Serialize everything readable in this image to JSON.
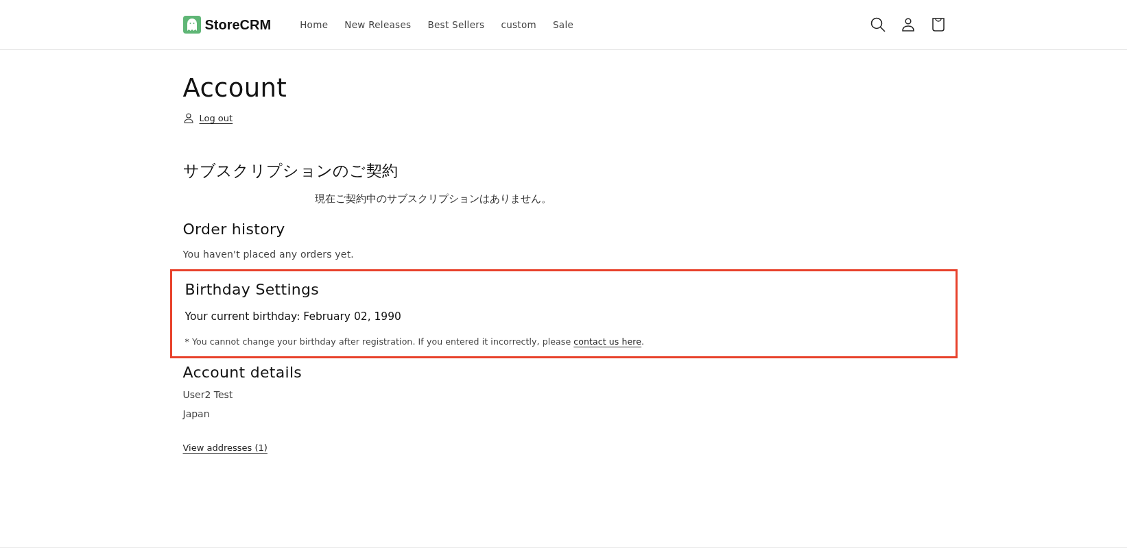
{
  "header": {
    "logo_text": "StoreCRM",
    "nav": [
      {
        "label": "Home"
      },
      {
        "label": "New Releases"
      },
      {
        "label": "Best Sellers"
      },
      {
        "label": "custom"
      },
      {
        "label": "Sale"
      }
    ]
  },
  "account": {
    "title": "Account",
    "logout": "Log out"
  },
  "subscriptions": {
    "heading": "サブスクリプションのご契約",
    "message": "現在ご契約中のサブスクリプションはありません。"
  },
  "order_history": {
    "heading": "Order history",
    "message": "You haven't placed any orders yet."
  },
  "birthday": {
    "highlighted": true,
    "heading": "Birthday Settings",
    "current": "Your current birthday: February 02, 1990",
    "note": "* You cannot change your birthday after registration. If you entered it incorrectly, please ",
    "link": "contact us here",
    "note_end": "."
  },
  "account_details": {
    "heading": "Account details",
    "lines": [
      "User2 Test",
      "Japan"
    ],
    "addresses_link": "View addresses (1)"
  }
}
